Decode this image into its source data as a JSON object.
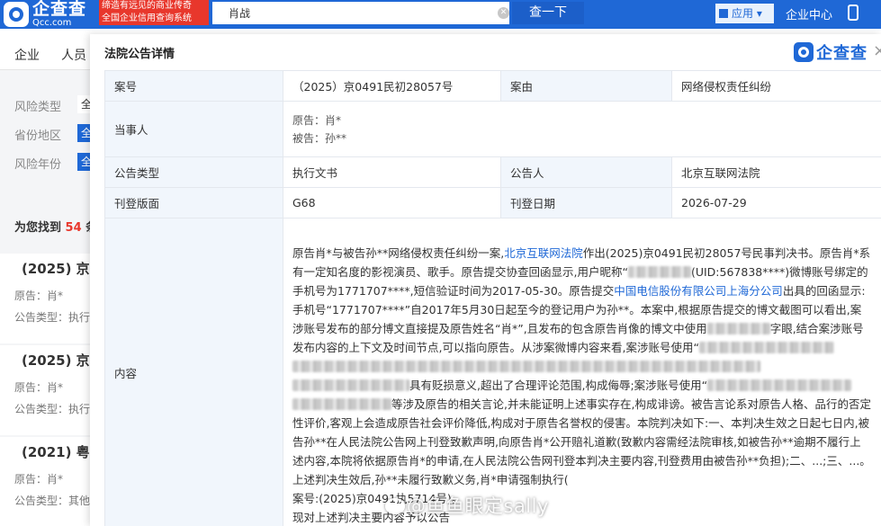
{
  "header": {
    "logo_cn": "企查查",
    "logo_en": "Qcc.com",
    "slogan_line1": "缔造有远见的商业传奇",
    "slogan_line2": "全国企业信用查询系统",
    "search_value": "肖战",
    "search_button": "查一下",
    "app_menu": "应用",
    "user_center": "企业中心"
  },
  "nav": {
    "items": [
      "企业",
      "人员"
    ]
  },
  "filters": {
    "rows": [
      {
        "label": "风险类型",
        "chip": "全"
      },
      {
        "label": "省份地区",
        "chip": "全"
      },
      {
        "label": "风险年份",
        "chip": "全"
      }
    ]
  },
  "results": {
    "prefix": "为您找到",
    "count": "54",
    "suffix": "条",
    "cards": [
      {
        "case_no": "(2025) 京",
        "line1": "原告：肖*",
        "line2": "公告类型：执行"
      },
      {
        "case_no": "(2025) 京",
        "line1": "原告：肖*",
        "line2": "公告类型：执行"
      },
      {
        "case_no": "(2021) 粤",
        "line1": "原告：肖*",
        "line2": "公告类型：其他"
      }
    ]
  },
  "modal": {
    "title": "法院公告详情",
    "brand": "企查查",
    "close": "×",
    "fields": {
      "case_no_label": "案号",
      "case_no_value": "（2025）京0491民初28057号",
      "cause_label": "案由",
      "cause_value": "网络侵权责任纠纷",
      "party_label": "当事人",
      "plaintiff": "原告：肖*",
      "defendant": "被告：孙**",
      "type_label": "公告类型",
      "type_value": "执行文书",
      "publisher_label": "公告人",
      "publisher_value": "北京互联网法院",
      "page_label": "刊登版面",
      "page_value": "G68",
      "date_label": "刊登日期",
      "date_value": "2026-07-29",
      "content_label": "内容"
    },
    "content": {
      "p1a": "原告肖*与被告孙**网络侵权责任纠纷一案,",
      "p1_link": "北京互联网法院",
      "p1b": "作出(2025)京0491民初28057号民事判决书。原告肖*系有一定知名度的影视演员、歌手。原告提交协查回函显示,用户昵称“",
      "p1c": "(UID:567838****)微博账号绑定的手机号为1771707****,短信验证时间为2017-05-30。原告提交",
      "p1_link2": "中国电信股份有限公司上海分公司",
      "p1d": "出具的回函显示:手机号“1771707****”自2017年5月30日起至今的登记用户为孙**。本案中,根据原告提交的博文截图可以看出,案涉账号发布的部分博文直接提及原告姓名“肖*”,且发布的包含原告肖像的博文中使用",
      "p1e": "字眼,结合案涉账号发布内容的上下文及时间节点,可以指向原告。从涉案微博内容来看,案涉账号使用“",
      "p1f": "具有贬损意义,超出了合理评论范围,构成侮辱;案涉账号使用“",
      "p1g": "等涉及原告的相关言论,并未能证明上述事实存在,构成诽谤。被告言论系对原告人格、品行的否定性评价,客观上会造成原告社会评价降低,构成对于原告名誉权的侵害。本院判决如下:一、本判决生效之日起七日内,被告孙**在人民法院公告网上刊登致歉声明,向原告肖*公开赔礼道歉(致歉内容需经法院审核,如被告孙**逾期不履行上述内容,本院将依据原告肖*的申请,在人民法院公告网刊登本判决主要内容,刊登费用由被告孙**负担);二、...;三、...。",
      "p2": "上述判决生效后,孙**未履行致歉义务,肖*申请强制执行(",
      "p3": "案号:(2025)京0491执5714号)。",
      "p4": "现对上述判决主要内容予以公告"
    }
  },
  "watermark": "@鱼鱼眼定sally",
  "colors": {
    "brand_blue": "#1f68d6",
    "label_bg": "#f1f6fc",
    "accent_red": "#e8372c"
  }
}
